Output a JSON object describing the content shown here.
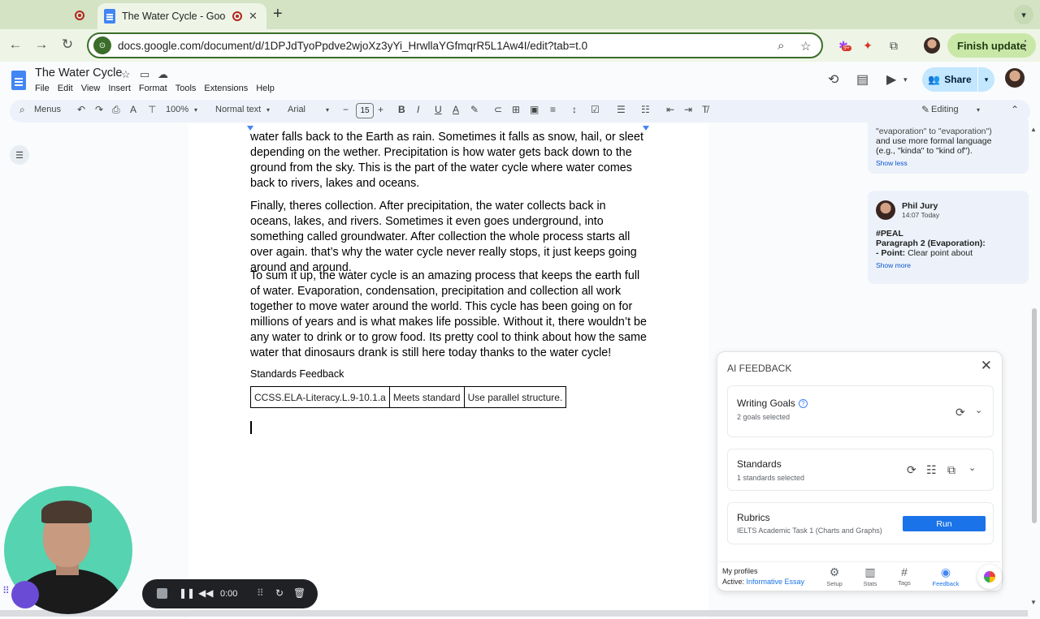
{
  "browser": {
    "active_tab_title": "The Water Cycle - Google Docs",
    "url": "docs.google.com/document/d/1DPJdTyoPpdve2wjoXz3yYi_HrwllaYGfmqrR5L1Aw4I/edit?tab=t.0",
    "finish_update_label": "Finish update",
    "extension_badge": "9+"
  },
  "docs": {
    "title": "The Water Cycle",
    "menu": [
      "File",
      "Edit",
      "View",
      "Insert",
      "Format",
      "Tools",
      "Extensions",
      "Help"
    ],
    "share_label": "Share"
  },
  "format_toolbar": {
    "menus_label": "Menus",
    "zoom": "100%",
    "style": "Normal text",
    "font": "Arial",
    "font_size": "15",
    "mode": "Editing"
  },
  "document": {
    "paragraph_1": "water falls back to the Earth as rain. Sometimes it falls as snow, hail, or sleet depending on the wether. Precipitation is how water gets back down to the ground from the sky. This is the part of the water cycle where water comes back to rivers, lakes and oceans.",
    "paragraph_2": "Finally, theres collection. After precipitation, the water collects back in oceans, lakes, and rivers. Sometimes it even goes underground, into something called groundwater. After collection the whole process starts all over again. that’s why the water cycle never really stops, it just keeps going around and around.",
    "paragraph_3": "To sum it up, the water cycle is an amazing process that keeps the earth full of water. Evaporation, condensation, precipitation and collection all work together to move water around the world. This cycle has been going on for millions of years and is what makes life possible. Without it, there wouldn’t be any water to drink or to grow food. Its pretty cool to think about how the same water that dinosaurs drank is still here today thanks to the water cycle!",
    "standards_heading": "Standards Feedback",
    "standards_table": [
      [
        "CCSS.ELA-Literacy.L.9-10.1.a",
        "Meets standard",
        "Use parallel structure."
      ]
    ]
  },
  "comments": [
    {
      "text_line1": "\"evaporation\" to \"evaporation\")",
      "text_line2": "and use more formal language",
      "text_line3": "(e.g., \"kinda\" to \"kind of\").",
      "toggle": "Show less"
    },
    {
      "author": "Phil Jury",
      "time": "14:07 Today",
      "tag": "#PEAL",
      "line1": "Paragraph 2 (Evaporation):",
      "line2_bold": "- Point:",
      "line2_rest": " Clear point about",
      "toggle": "Show more"
    }
  ],
  "ai_feedback": {
    "title": "AI FEEDBACK",
    "writing_goals": {
      "title": "Writing Goals",
      "subtitle": "2 goals selected"
    },
    "standards": {
      "title": "Standards",
      "subtitle": "1 standards selected"
    },
    "rubrics": {
      "title": "Rubrics",
      "subtitle": "IELTS Academic Task 1 (Charts and Graphs)",
      "run_label": "Run"
    },
    "footer": {
      "profiles_label": "My profiles",
      "active_prefix": "Active: ",
      "active_profile": "Informative Essay",
      "tabs": [
        "Setup",
        "Stats",
        "Tags",
        "Feedback"
      ]
    }
  },
  "recorder": {
    "time": "0:00"
  }
}
